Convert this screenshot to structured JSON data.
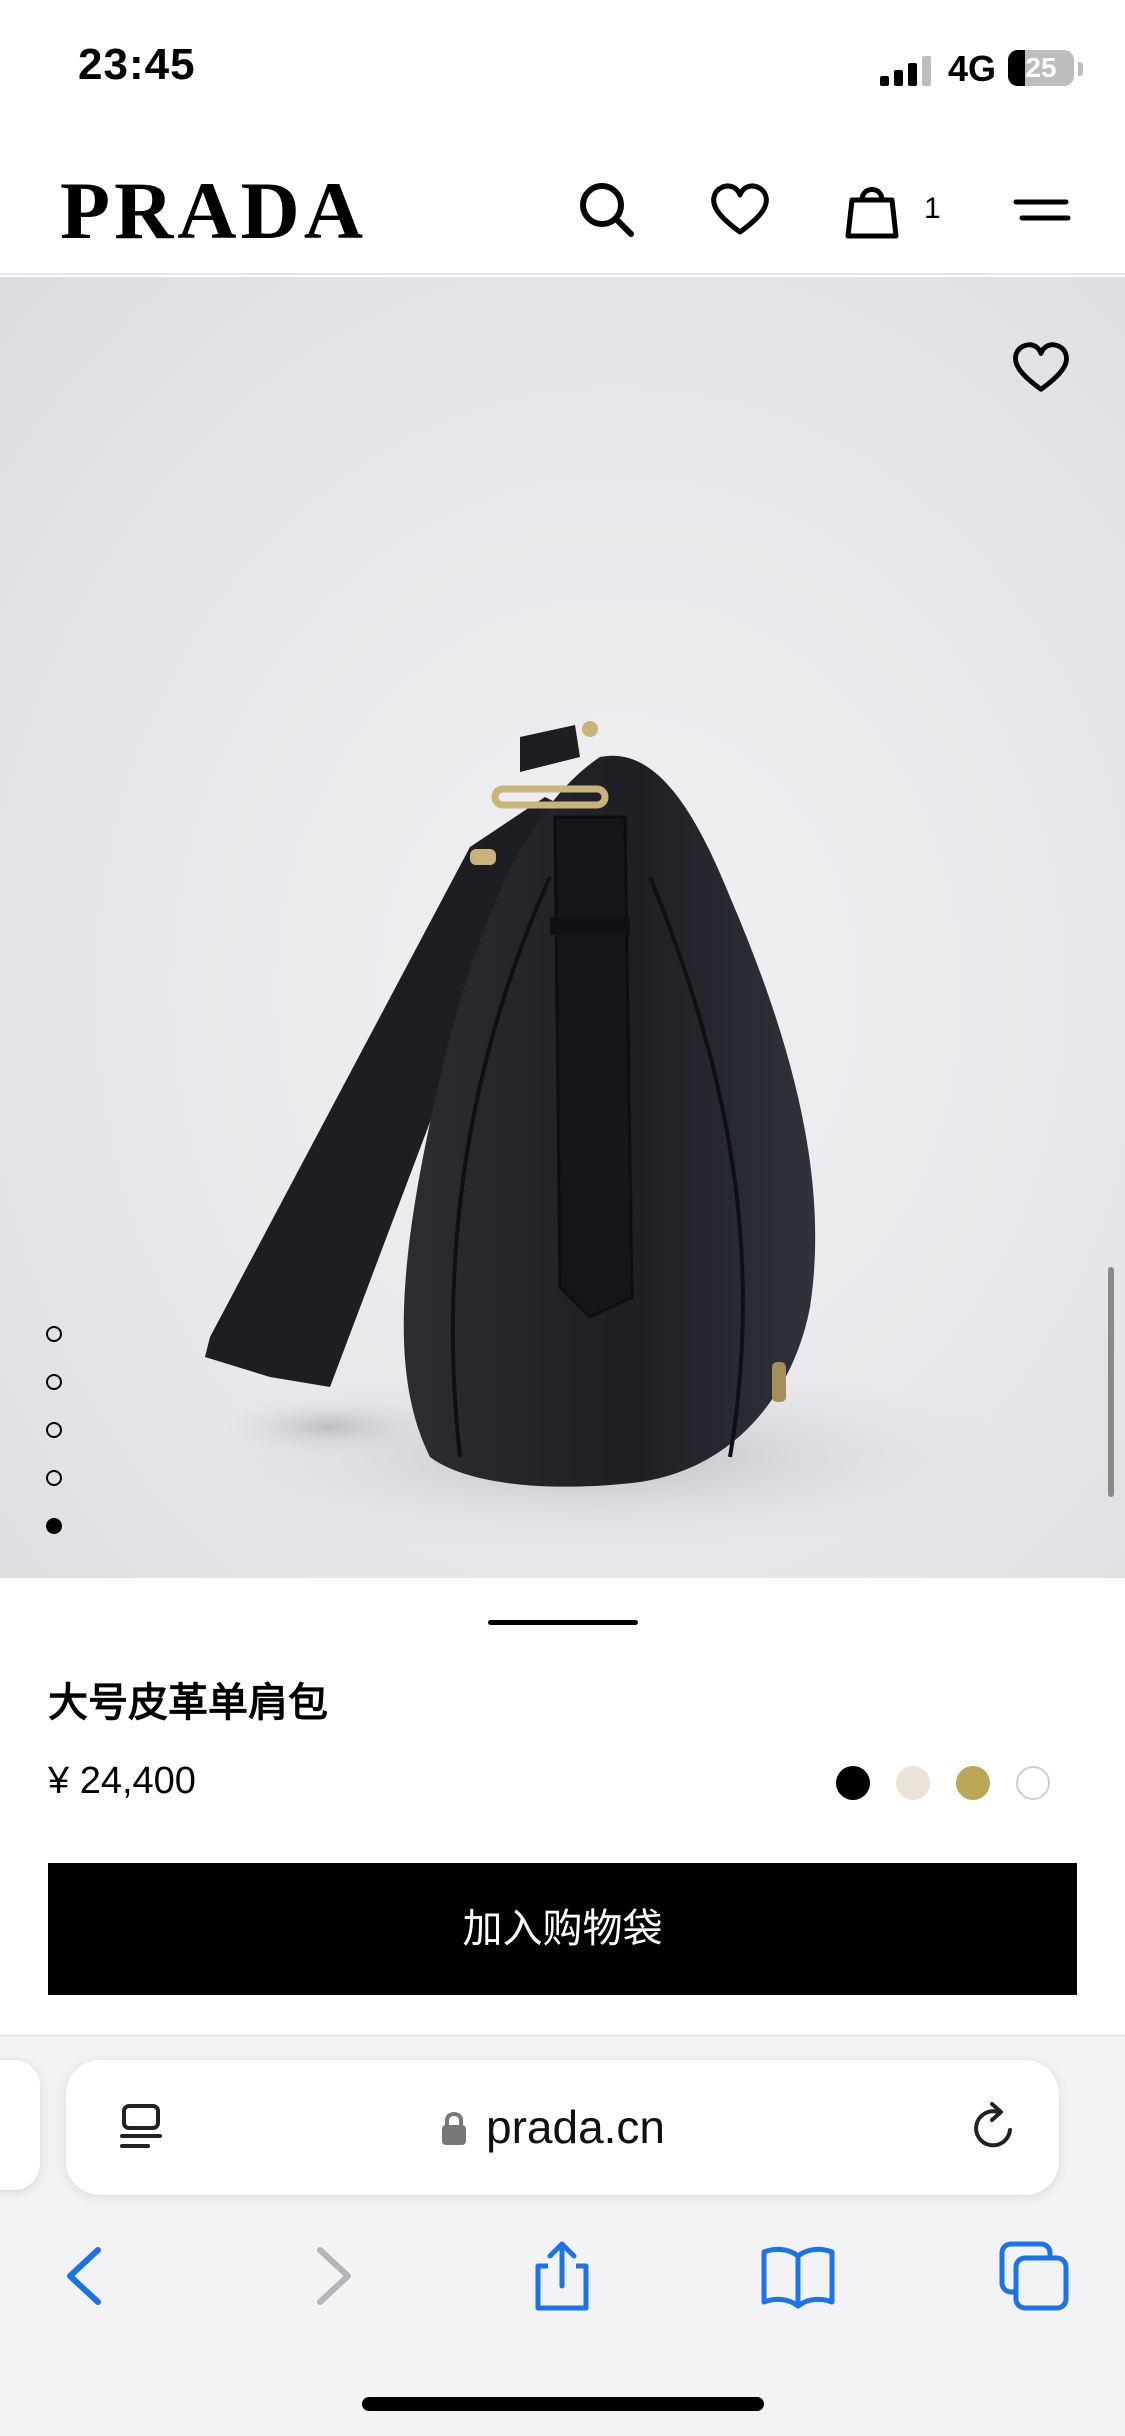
{
  "status_bar": {
    "time": "23:45",
    "network": "4G",
    "battery": "25"
  },
  "header": {
    "logo": "PRADA",
    "cart_count": "1",
    "icons": [
      "search-icon",
      "heart-icon",
      "shopping-bag-icon",
      "menu-icon"
    ]
  },
  "hero": {
    "favorite_icon": "heart-icon",
    "carousel_total": 5,
    "carousel_active_index": 5
  },
  "product": {
    "name": "大号皮革单肩包",
    "price": "¥ 24,400",
    "swatches": [
      {
        "color": "#000000",
        "selected": true
      },
      {
        "color": "#ebe3d8",
        "selected": false
      },
      {
        "color": "#b9a657",
        "selected": false
      },
      {
        "color": "#ffffff",
        "selected": false
      }
    ],
    "add_to_bag_label": "加入购物袋"
  },
  "browser": {
    "url": "prada.cn",
    "icons": [
      "reader-icon",
      "lock-icon",
      "reload-icon",
      "back-icon",
      "forward-icon",
      "share-icon",
      "bookmarks-icon",
      "tabs-icon"
    ]
  }
}
